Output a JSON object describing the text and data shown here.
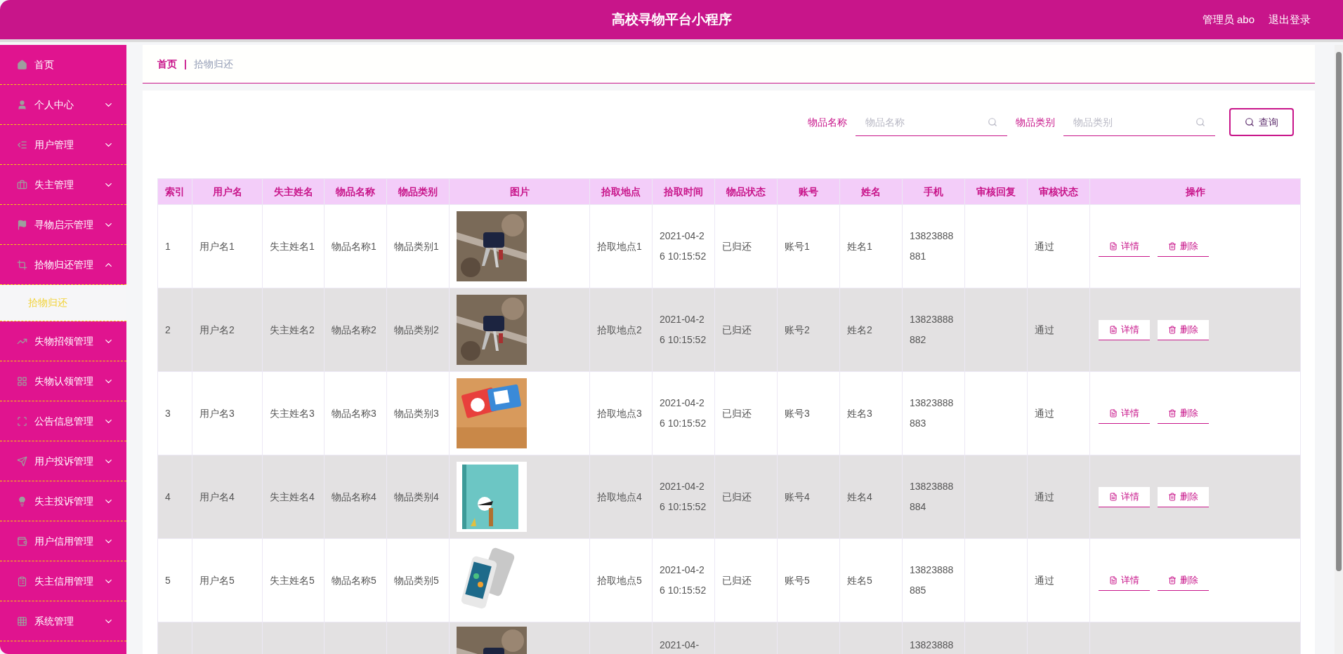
{
  "header": {
    "title": "高校寻物平台小程序",
    "user": "管理员 abo",
    "logout": "退出登录"
  },
  "sidebar": {
    "items": [
      {
        "label": "首页",
        "kind": "link"
      },
      {
        "label": "个人中心",
        "kind": "menu",
        "expanded": false
      },
      {
        "label": "用户管理",
        "kind": "menu",
        "expanded": false
      },
      {
        "label": "失主管理",
        "kind": "menu",
        "expanded": false
      },
      {
        "label": "寻物启示管理",
        "kind": "menu",
        "expanded": false
      },
      {
        "label": "拾物归还管理",
        "kind": "menu",
        "expanded": true,
        "children": [
          {
            "label": "拾物归还",
            "selected": true
          }
        ]
      },
      {
        "label": "失物招领管理",
        "kind": "menu",
        "expanded": false
      },
      {
        "label": "失物认领管理",
        "kind": "menu",
        "expanded": false
      },
      {
        "label": "公告信息管理",
        "kind": "menu",
        "expanded": false
      },
      {
        "label": "用户投诉管理",
        "kind": "menu",
        "expanded": false
      },
      {
        "label": "失主投诉管理",
        "kind": "menu",
        "expanded": false
      },
      {
        "label": "用户信用管理",
        "kind": "menu",
        "expanded": false
      },
      {
        "label": "失主信用管理",
        "kind": "menu",
        "expanded": false
      },
      {
        "label": "系统管理",
        "kind": "menu",
        "expanded": false
      }
    ]
  },
  "breadcrumb": {
    "home": "首页",
    "separator": "|",
    "current": "拾物归还"
  },
  "search": {
    "fields": [
      {
        "label": "物品名称",
        "placeholder": "物品名称"
      },
      {
        "label": "物品类别",
        "placeholder": "物品类别"
      }
    ],
    "button": "查询"
  },
  "table": {
    "columns": [
      "索引",
      "用户名",
      "失主姓名",
      "物品名称",
      "物品类别",
      "图片",
      "拾取地点",
      "拾取时间",
      "物品状态",
      "账号",
      "姓名",
      "手机",
      "审核回复",
      "审核状态",
      "操作"
    ],
    "rows": [
      {
        "index": "1",
        "username": "用户名1",
        "owner": "失主姓名1",
        "item_name": "物品名称1",
        "item_type": "物品类别1",
        "place": "拾取地点1",
        "time": "2021-04-26 10:15:52",
        "item_status": "已归还",
        "account": "账号1",
        "name": "姓名1",
        "phone": "13823888881",
        "review_status": "通过",
        "actions": [
          "详情",
          "删除"
        ]
      },
      {
        "index": "2",
        "username": "用户名2",
        "owner": "失主姓名2",
        "item_name": "物品名称2",
        "item_type": "物品类别2",
        "place": "拾取地点2",
        "time": "2021-04-26 10:15:52",
        "item_status": "已归还",
        "account": "账号2",
        "name": "姓名2",
        "phone": "13823888882",
        "review_status": "通过",
        "actions": [
          "详情",
          "删除"
        ]
      },
      {
        "index": "3",
        "username": "用户名3",
        "owner": "失主姓名3",
        "item_name": "物品名称3",
        "item_type": "物品类别3",
        "place": "拾取地点3",
        "time": "2021-04-26 10:15:52",
        "item_status": "已归还",
        "account": "账号3",
        "name": "姓名3",
        "phone": "13823888883",
        "review_status": "通过",
        "actions": [
          "详情",
          "删除"
        ]
      },
      {
        "index": "4",
        "username": "用户名4",
        "owner": "失主姓名4",
        "item_name": "物品名称4",
        "item_type": "物品类别4",
        "place": "拾取地点4",
        "time": "2021-04-26 10:15:52",
        "item_status": "已归还",
        "account": "账号4",
        "name": "姓名4",
        "phone": "13823888884",
        "review_status": "通过",
        "actions": [
          "详情",
          "删除"
        ]
      },
      {
        "index": "5",
        "username": "用户名5",
        "owner": "失主姓名5",
        "item_name": "物品名称5",
        "item_type": "物品类别5",
        "place": "拾取地点5",
        "time": "2021-04-26 10:15:52",
        "item_status": "已归还",
        "account": "账号5",
        "name": "姓名5",
        "phone": "13823888885",
        "review_status": "通过",
        "actions": [
          "详情",
          "删除"
        ]
      },
      {
        "time": "2021-04-",
        "phone": "13823888"
      }
    ]
  }
}
